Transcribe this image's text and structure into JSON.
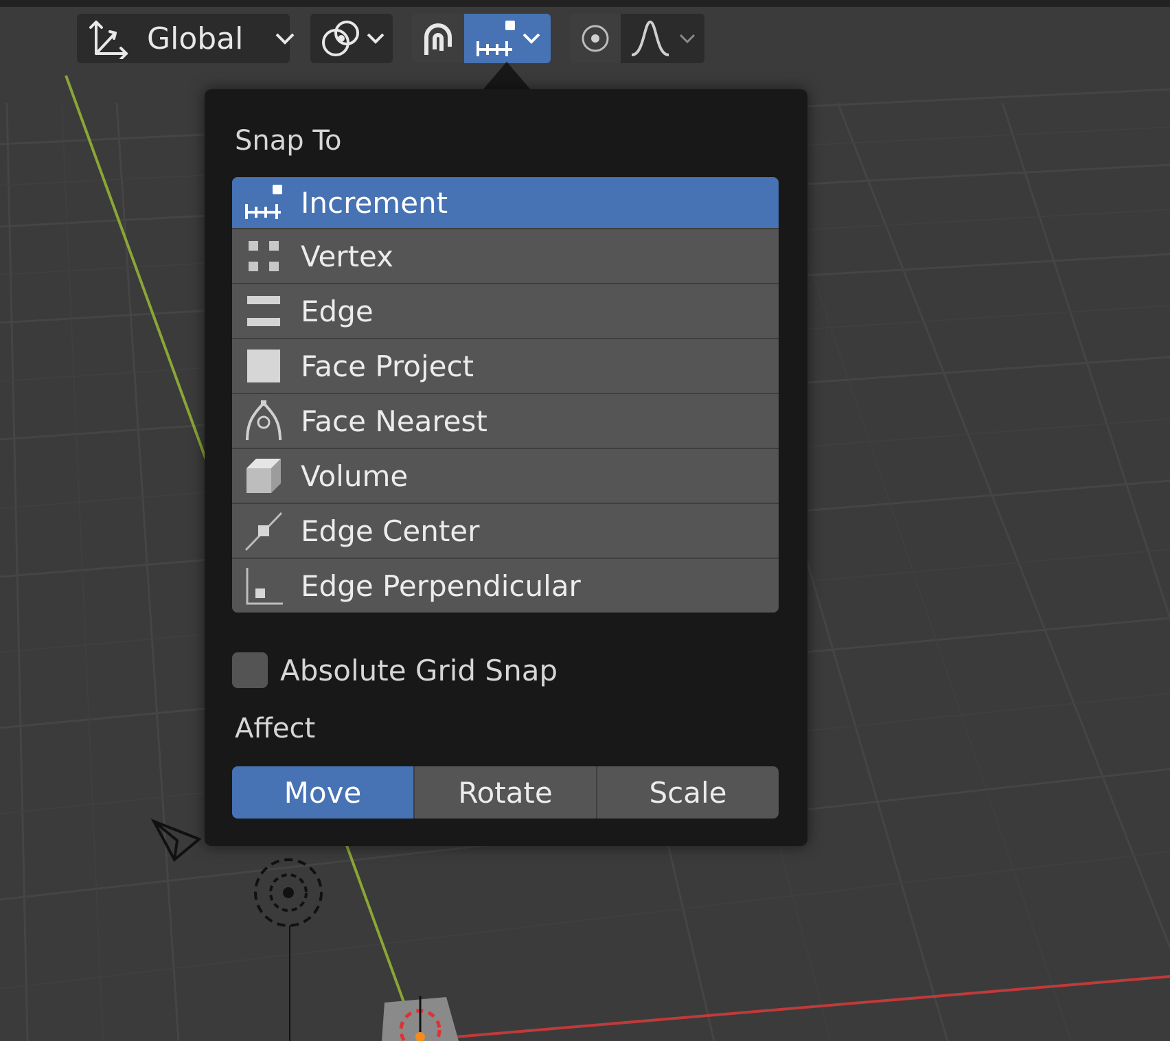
{
  "header": {
    "transform_orientation": {
      "value": "Global",
      "icon": "transform-axes-icon"
    },
    "pivot": {
      "icon": "pivot-point-icon"
    },
    "snap_toggle": {
      "icon": "magnet-icon"
    },
    "snap_target": {
      "icon": "increment-icon",
      "active": true
    },
    "proportional": {
      "icon": "proportional-edit-icon"
    },
    "falloff": {
      "icon": "falloff-curve-icon"
    }
  },
  "snap_popover": {
    "snap_to_label": "Snap To",
    "items": [
      {
        "label": "Increment",
        "icon": "increment-icon",
        "selected": true
      },
      {
        "label": "Vertex",
        "icon": "vertex-icon",
        "selected": false
      },
      {
        "label": "Edge",
        "icon": "edge-icon",
        "selected": false
      },
      {
        "label": "Face Project",
        "icon": "face-project-icon",
        "selected": false
      },
      {
        "label": "Face Nearest",
        "icon": "face-nearest-icon",
        "selected": false
      },
      {
        "label": "Volume",
        "icon": "volume-icon",
        "selected": false
      },
      {
        "label": "Edge Center",
        "icon": "edge-center-icon",
        "selected": false
      },
      {
        "label": "Edge Perpendicular",
        "icon": "edge-perpendicular-icon",
        "selected": false
      }
    ],
    "absolute_grid_snap": {
      "label": "Absolute Grid Snap",
      "checked": false
    },
    "affect_label": "Affect",
    "affect": [
      {
        "label": "Move",
        "active": true
      },
      {
        "label": "Rotate",
        "active": false
      },
      {
        "label": "Scale",
        "active": false
      }
    ]
  },
  "colors": {
    "accent": "#4772b3",
    "panel": "#181818",
    "item": "#555555",
    "viewport": "#3b3b3b",
    "y_axis": "#8aa636",
    "x_axis": "#c03a3a"
  }
}
